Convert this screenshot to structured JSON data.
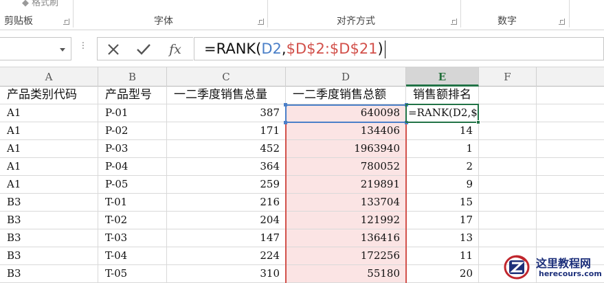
{
  "ribbon": {
    "cut_item_label": "格式刷",
    "groups": [
      {
        "label": "剪贴板"
      },
      {
        "label": "字体"
      },
      {
        "label": "对齐方式"
      },
      {
        "label": "数字"
      }
    ]
  },
  "formula_bar": {
    "namebox_value": "",
    "cancel_icon": "close-icon",
    "enter_icon": "check-icon",
    "fx_label": "fx",
    "formula_parts": {
      "prefix": "=RANK(",
      "ref1": "D2",
      "comma": ",",
      "ref2": "$D$2:$D$21",
      "suffix": ")"
    },
    "ref1_color": "#4a7fc8",
    "ref2_color": "#d2504a"
  },
  "sheet": {
    "columns": [
      "A",
      "B",
      "C",
      "D",
      "E",
      "F"
    ],
    "active_column": "E",
    "headers": [
      "产品类别代码",
      "产品型号",
      "一二季度销售总量",
      "一二季度销售总额",
      "销售额排名"
    ],
    "rows": [
      {
        "a": "A1",
        "b": "P-01",
        "c": "387",
        "d": "640098",
        "e": "=RANK(D2,$"
      },
      {
        "a": "A1",
        "b": "P-02",
        "c": "171",
        "d": "134406",
        "e": "14"
      },
      {
        "a": "A1",
        "b": "P-03",
        "c": "452",
        "d": "1963940",
        "e": "1"
      },
      {
        "a": "A1",
        "b": "P-04",
        "c": "364",
        "d": "780052",
        "e": "2"
      },
      {
        "a": "A1",
        "b": "P-05",
        "c": "259",
        "d": "219891",
        "e": "9"
      },
      {
        "a": "B3",
        "b": "T-01",
        "c": "216",
        "d": "133704",
        "e": "15"
      },
      {
        "a": "B3",
        "b": "T-02",
        "c": "204",
        "d": "121992",
        "e": "17"
      },
      {
        "a": "B3",
        "b": "T-03",
        "c": "147",
        "d": "136416",
        "e": "13"
      },
      {
        "a": "B3",
        "b": "T-04",
        "c": "224",
        "d": "172256",
        "e": "11"
      },
      {
        "a": "B3",
        "b": "T-05",
        "c": "310",
        "d": "55180",
        "e": "20"
      }
    ],
    "accent_color": "#217346",
    "range_fill": "#fbe4e4"
  },
  "watermark": {
    "logo_icon": "z-logo-icon",
    "title": "这里教程网",
    "url": "herecours.com"
  }
}
